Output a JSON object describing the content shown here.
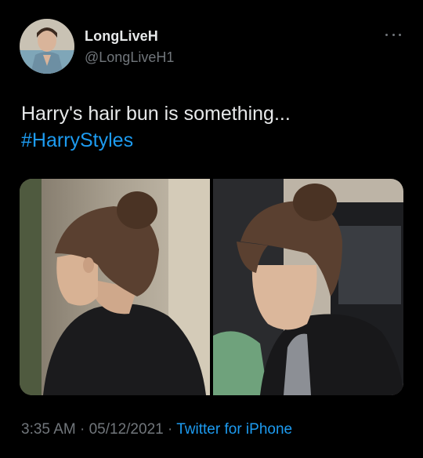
{
  "tweet": {
    "author_name": "LongLiveH",
    "author_handle": "@LongLiveH1",
    "text_line1": "Harry's hair bun is something...",
    "hashtag": "#HarryStyles",
    "time": "3:35 AM",
    "date": "05/12/2021",
    "separator": "·",
    "source": "Twitter for iPhone"
  },
  "icons": {
    "more": "more-horizontal-icon"
  },
  "colors": {
    "background": "#000000",
    "text_primary": "#e7e9ea",
    "text_secondary": "#71767b",
    "accent": "#1d9bf0"
  }
}
